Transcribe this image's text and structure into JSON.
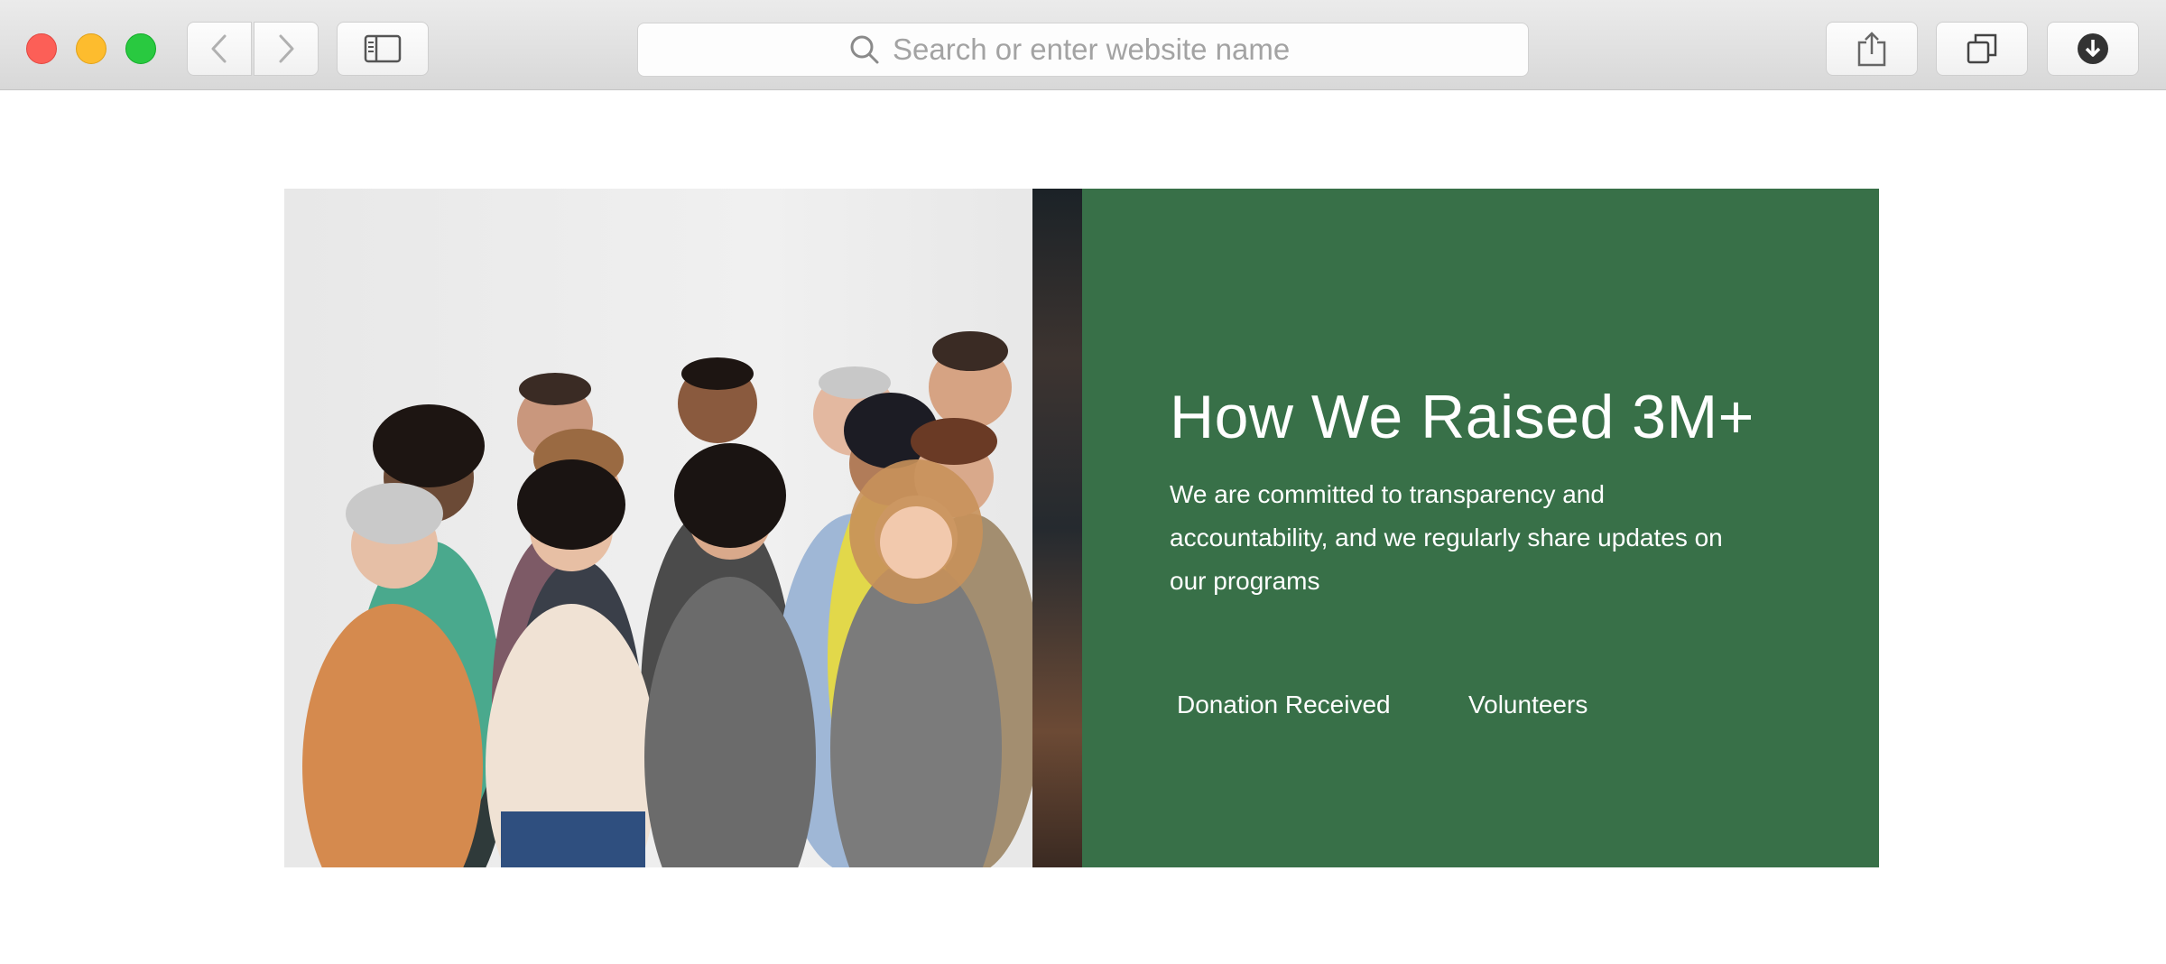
{
  "browser": {
    "address_placeholder": "Search or enter website name",
    "icons": {
      "back": "chevron-left-icon",
      "forward": "chevron-right-icon",
      "sidebar": "sidebar-icon",
      "search": "search-icon",
      "share": "share-icon",
      "tabs": "tabs-icon",
      "download": "download-icon"
    }
  },
  "hero": {
    "title": "How We Raised 3M+",
    "description": "We are committed to transparency and accountability, and we regularly share updates on our programs",
    "stats": [
      {
        "label": "Donation Received"
      },
      {
        "label": "Volunteers"
      }
    ],
    "colors": {
      "panel": "#387048",
      "text": "#ffffff"
    }
  }
}
